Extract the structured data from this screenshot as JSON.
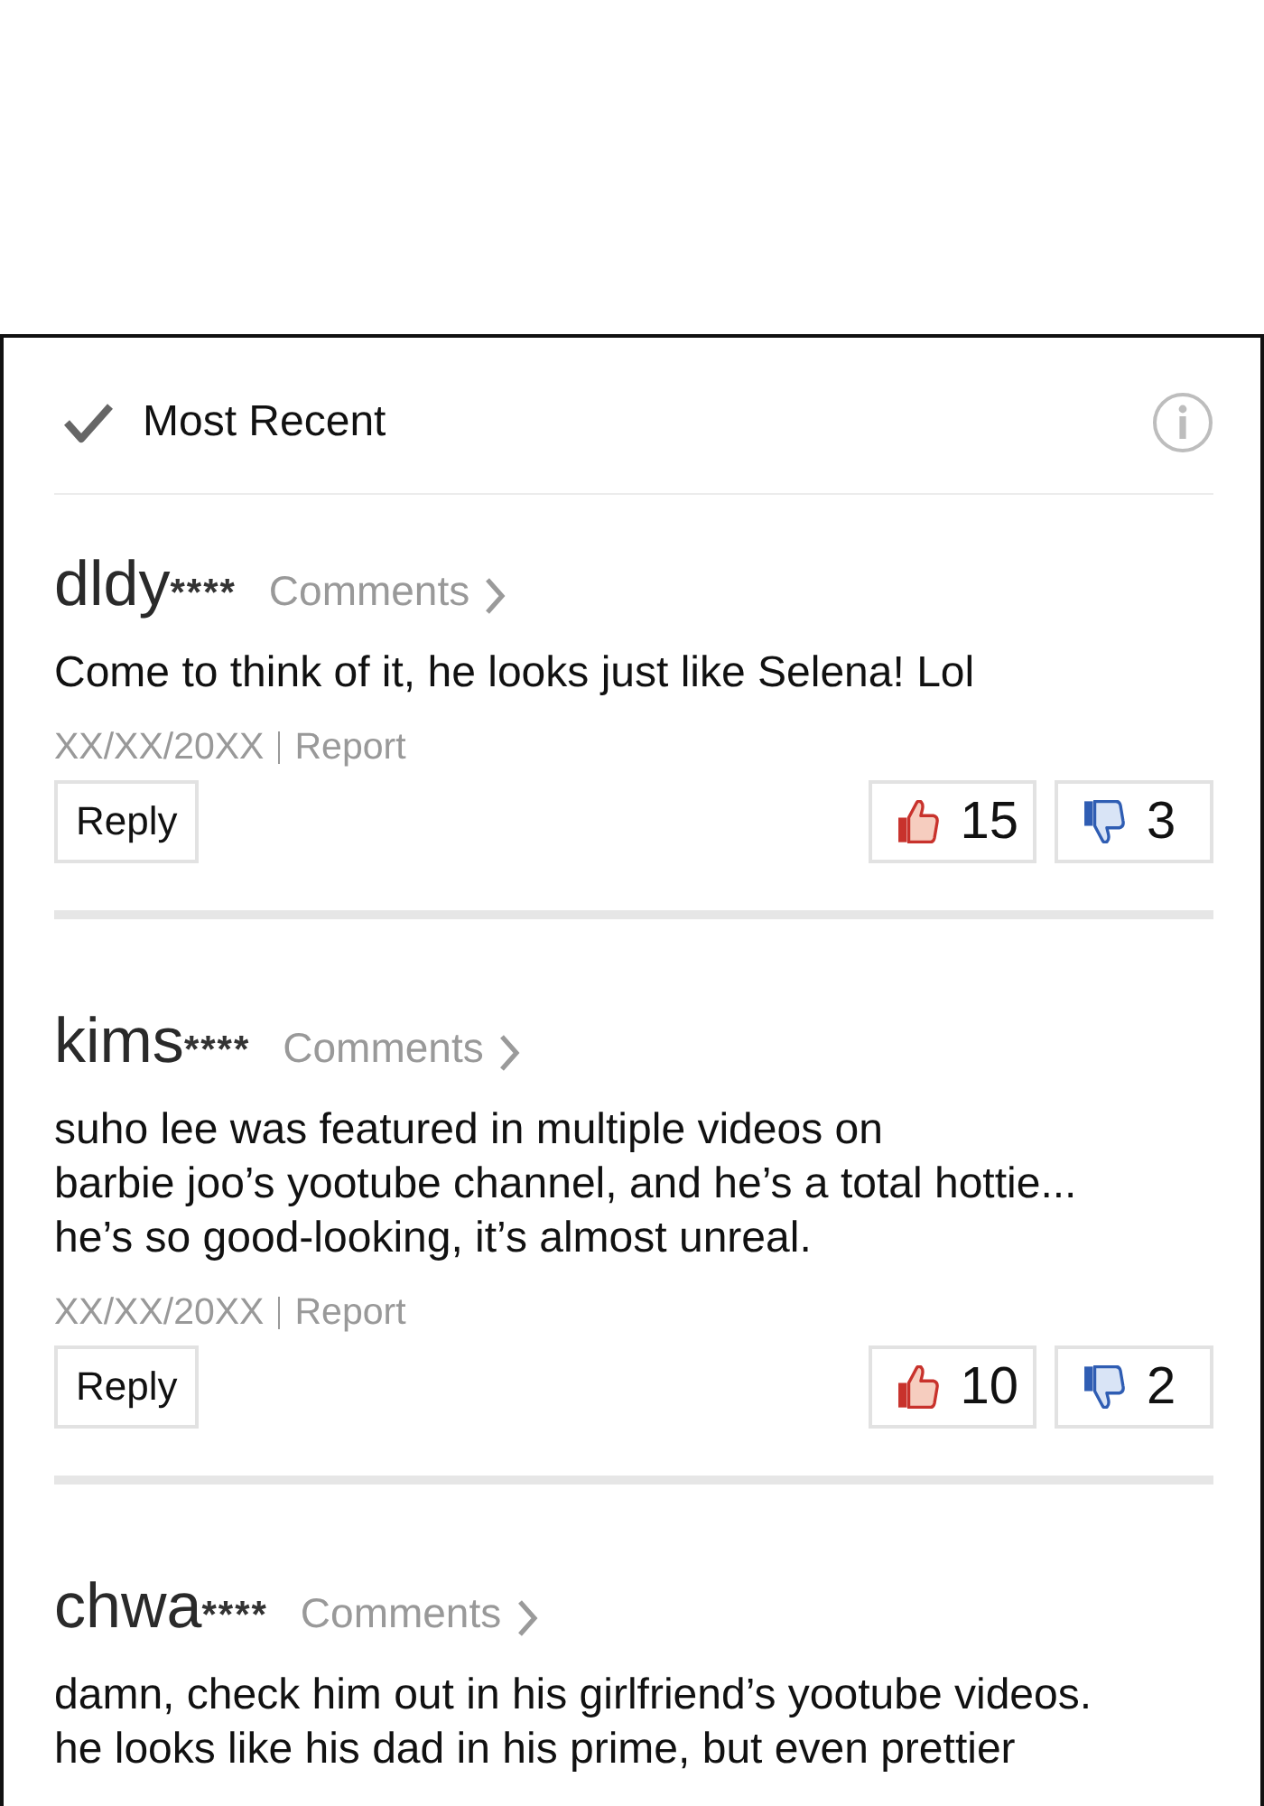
{
  "sort_option": {
    "label": "Most Recent",
    "selected": true
  },
  "comments": [
    {
      "user": "dldy",
      "mask": "****",
      "comments_link": "Comments",
      "body": "Come to think of it, he looks just like Selena! Lol",
      "date": "XX/XX/20XX",
      "report": "Report",
      "reply": "Reply",
      "likes": "15",
      "dislikes": "3"
    },
    {
      "user": "kims",
      "mask": "****",
      "comments_link": "Comments",
      "body": "suho lee was featured in multiple videos on\nbarbie joo’s yootube channel, and he’s a total hottie...\nhe’s so good-looking, it’s almost unreal.",
      "date": "XX/XX/20XX",
      "report": "Report",
      "reply": "Reply",
      "likes": "10",
      "dislikes": "2"
    },
    {
      "user": "chwa",
      "mask": "****",
      "comments_link": "Comments",
      "body": "damn, check him out in his girlfriend’s yootube videos.\nhe looks like his dad in his prime, but even prettier"
    }
  ]
}
